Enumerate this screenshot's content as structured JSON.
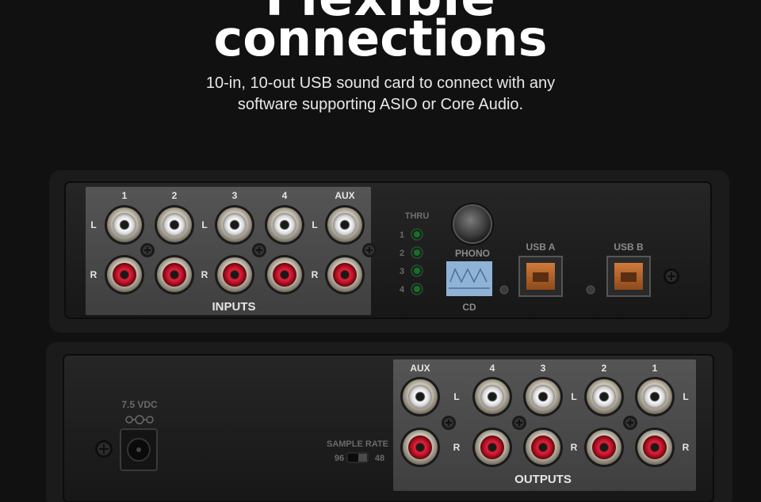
{
  "hero": {
    "title_partial": "Flexible",
    "title": "connections",
    "subtitle_line1": "10-in, 10-out USB sound card to connect with any",
    "subtitle_line2": "software supporting ASIO or Core Audio."
  },
  "top_panel": {
    "channel_labels": [
      "1",
      "2",
      "3",
      "4",
      "AUX"
    ],
    "left_label": "L",
    "right_label": "R",
    "inputs_label": "INPUTS",
    "thru_label": "THRU",
    "thru_numbers": [
      "1",
      "2",
      "3",
      "4"
    ],
    "phono_label": "PHONO",
    "cd_label": "CD",
    "usb_a_label": "USB A",
    "usb_b_label": "USB B"
  },
  "bottom_panel": {
    "channel_labels": [
      "AUX",
      "4",
      "3",
      "2",
      "1"
    ],
    "left_label": "L",
    "right_label": "R",
    "outputs_label": "OUTPUTS",
    "power_label": "7.5 VDC",
    "sample_rate_label": "SAMPLE RATE",
    "sample_rate_low": "96",
    "sample_rate_high": "48"
  },
  "colors": {
    "background": "#111111",
    "panel": "#1f1f1f",
    "plate": "#4a4a4a",
    "rca_red": "#c8102e",
    "rca_white": "#f2f2f2",
    "usb_orange": "#b8652a",
    "led_green": "#1e6b2e"
  }
}
